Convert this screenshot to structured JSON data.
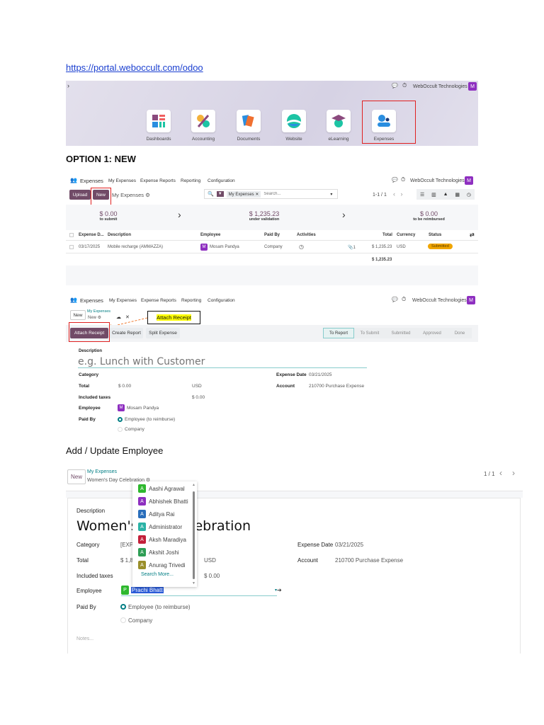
{
  "link": "https://portal.weboccult.com/odoo",
  "company": "WebOccult Technologies",
  "avatar_letter": "M",
  "home": {
    "apps": [
      {
        "label": "Dashboards"
      },
      {
        "label": "Accounting"
      },
      {
        "label": "Documents"
      },
      {
        "label": "Website"
      },
      {
        "label": "eLearning"
      },
      {
        "label": "Expenses"
      }
    ]
  },
  "heading1": "OPTION 1: NEW",
  "nav": {
    "app": "Expenses",
    "items": [
      "My Expenses",
      "Expense Reports",
      "Reporting",
      "Configuration"
    ]
  },
  "list": {
    "upload": "Upload",
    "new": "New",
    "title": "My Expenses ⚙",
    "filter": "My Expenses",
    "search_placeholder": "Search...",
    "pager": "1-1 / 1",
    "summary": [
      {
        "amount": "$ 0.00",
        "label": "to submit"
      },
      {
        "amount": "$ 1,235.23",
        "label": "under validation"
      },
      {
        "amount": "$ 0.00",
        "label": "to be reimbursed"
      }
    ],
    "columns": [
      "Expense D...",
      "Description",
      "Employee",
      "Paid By",
      "Activities",
      "Total",
      "Currency",
      "Status"
    ],
    "row": {
      "date": "03/17/2025",
      "description": "Mobile recharge (AMMAZZA)",
      "employee": "Mosam Pandya",
      "paid_by": "Company",
      "attachments": "1",
      "total": "$ 1,235.23",
      "currency": "USD",
      "status": "Submitted"
    },
    "grand_total": "$ 1,235.23"
  },
  "form1": {
    "new": "New",
    "breadcrumb": "My Expenses",
    "record": "New ⚙",
    "callout": "Attach Receipt",
    "buttons": [
      "Attach Receipt",
      "Create Report",
      "Split Expense"
    ],
    "stages": [
      "To Report",
      "To Submit",
      "Submitted",
      "Approved",
      "Done"
    ],
    "description_label": "Description",
    "description_placeholder": "e.g. Lunch with Customer",
    "category": "Category",
    "total": "Total",
    "total_val": "$ 0.00",
    "currency": "USD",
    "taxes": "Included taxes",
    "taxes_val": "$ 0.00",
    "employee": "Employee",
    "employee_val": "Mosam Pandya",
    "paid_by": "Paid By",
    "opt1": "Employee (to reimburse)",
    "opt2": "Company",
    "date_label": "Expense Date",
    "date_val": "03/21/2025",
    "account_label": "Account",
    "account_val": "210700 Purchase Expense"
  },
  "heading2": "Add / Update Employee",
  "form2": {
    "new": "New",
    "breadcrumb": "My Expenses",
    "record": "Women's Day Celebration ⚙",
    "pager": "1 / 1",
    "description_label": "Description",
    "title": "Women's Day Celebration",
    "category": "Category",
    "category_val": "[EXP",
    "total": "Total",
    "total_val": "$ 1,8",
    "currency": "USD",
    "taxes": "Included taxes",
    "taxes_val": "$ 0.00",
    "employee": "Employee",
    "employee_val": "Prachi Bhatt",
    "employee_letter": "P",
    "paid_by": "Paid By",
    "opt1": "Employee (to reimburse)",
    "opt2": "Company",
    "notes": "Notes...",
    "date_label": "Expense Date",
    "date_val": "03/21/2025",
    "account_label": "Account",
    "account_val": "210700 Purchase Expense",
    "dropdown": [
      {
        "name": "Aashi Agrawal",
        "color": "#2eb82e"
      },
      {
        "name": "Abhishek Bhatti",
        "color": "#8e2fc0"
      },
      {
        "name": "Aditya Rai",
        "color": "#2a6ebb"
      },
      {
        "name": "Administrator",
        "color": "#2bb3a6"
      },
      {
        "name": "Aksh Maradiya",
        "color": "#c3203a"
      },
      {
        "name": "Akshit Joshi",
        "color": "#2e9e55"
      },
      {
        "name": "Anurag Trivedi",
        "color": "#9a8f2b"
      }
    ],
    "search_more": "Search More..."
  }
}
